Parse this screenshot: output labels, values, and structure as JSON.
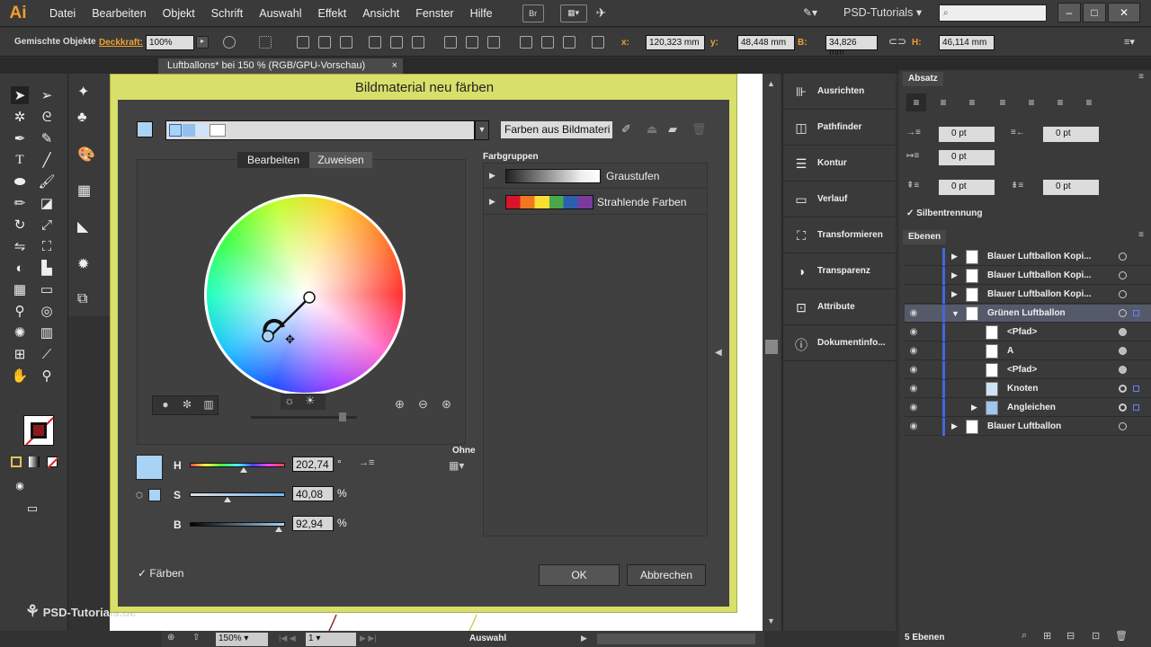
{
  "app": {
    "logo": "Ai",
    "workspace": "PSD-Tutorials"
  },
  "menu": [
    "Datei",
    "Bearbeiten",
    "Objekt",
    "Schrift",
    "Auswahl",
    "Effekt",
    "Ansicht",
    "Fenster",
    "Hilfe"
  ],
  "menu_buttons": {
    "br": "Br"
  },
  "control_bar": {
    "mixed_label": "Gemischte Objekte",
    "opacity_label": "Deckkraft:",
    "opacity_value": "100%",
    "x_label": "x:",
    "x_value": "120,323 mm",
    "y_label": "y:",
    "y_value": "48,448 mm",
    "w_label": "B:",
    "w_value": "34,826 mm",
    "h_label": "H:",
    "h_value": "46,114 mm"
  },
  "doc_tab": {
    "title": "Luftballons* bei 150 % (RGB/GPU-Vorschau)",
    "close": "×"
  },
  "left_panels": [
    "Pi",
    "Sy",
    "Fa",
    "Fa",
    "Fa",
    "Au",
    "Gr"
  ],
  "dock": [
    "Ausrichten",
    "Pathfinder",
    "Kontur",
    "Verlauf",
    "Transformieren",
    "Transparenz",
    "Attribute",
    "Dokumentinfo..."
  ],
  "absatz": {
    "title": "Absatz",
    "fields": [
      "0 pt",
      "0 pt",
      "0 pt",
      "0 pt",
      "0 pt"
    ],
    "hyphenation": "Silbentrennung"
  },
  "ebenen": {
    "title": "Ebenen",
    "count": "5 Ebenen",
    "layers": [
      {
        "name": "Blauer Luftballon Kopi..."
      },
      {
        "name": "Blauer Luftballon Kopi..."
      },
      {
        "name": "Blauer Luftballon Kopi..."
      },
      {
        "name": "Grünen Luftballon"
      },
      {
        "name": "<Pfad>"
      },
      {
        "name": "A"
      },
      {
        "name": "<Pfad>"
      },
      {
        "name": "Knoten"
      },
      {
        "name": "Angleichen"
      },
      {
        "name": "Blauer Luftballon"
      }
    ]
  },
  "dialog": {
    "title": "Bildmaterial neu färben",
    "colors_from_art": "Farben aus Bildmateri",
    "tab_edit": "Bearbeiten",
    "tab_assign": "Zuweisen",
    "groups_label": "Farbgruppen",
    "groups": [
      {
        "name": "Graustufen"
      },
      {
        "name": "Strahlende Farben"
      }
    ],
    "h_label": "H",
    "h_value": "202,74",
    "h_unit": "°",
    "s_label": "S",
    "s_value": "40,08",
    "s_unit": "%",
    "b_label": "B",
    "b_value": "92,94",
    "b_unit": "%",
    "none_label": "Ohne",
    "recolor_label": "Färben",
    "ok": "OK",
    "cancel": "Abbrechen",
    "h_level": 0.563,
    "s_level": 0.4,
    "b_level": 0.93,
    "selected_color": "#a9d3f5"
  },
  "status": {
    "zoom": "150%",
    "page": "1",
    "mode": "Auswahl"
  },
  "watermark": "PSD-Tutorials.de"
}
